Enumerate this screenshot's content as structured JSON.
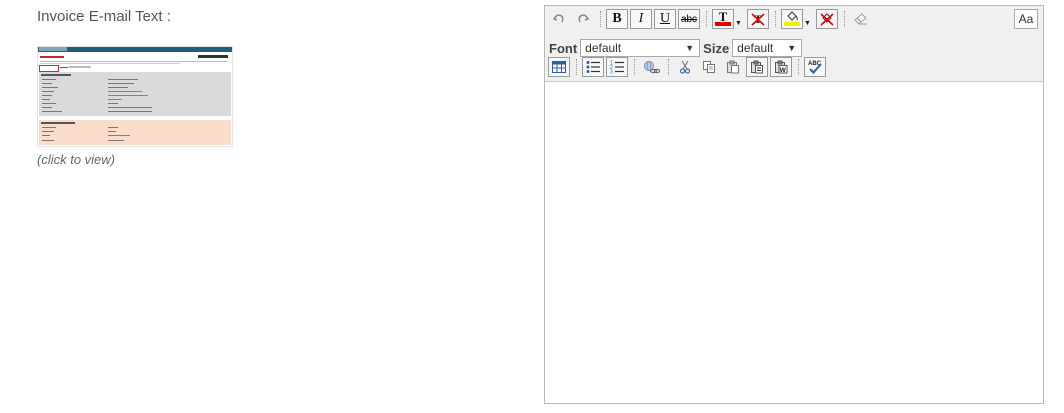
{
  "field": {
    "label": "Invoice E-mail Text :",
    "click_note": "(click to view)"
  },
  "thumbnail": {
    "header_color": "#1f5f7a",
    "gray_section_color": "#d9dadc",
    "peach_section_color": "#f9dcca"
  },
  "toolbar": {
    "case_button": "Aa",
    "text_color": "#e00000",
    "highlight_color": "#f4f000",
    "font": {
      "label": "Font",
      "value": "default"
    },
    "size": {
      "label": "Size",
      "value": "default"
    },
    "bold": "B",
    "italic": "I",
    "underline": "U",
    "strikethrough": "abc",
    "text_color_letter": "T",
    "spell_abc": "ABC"
  },
  "editor": {
    "content": ""
  }
}
